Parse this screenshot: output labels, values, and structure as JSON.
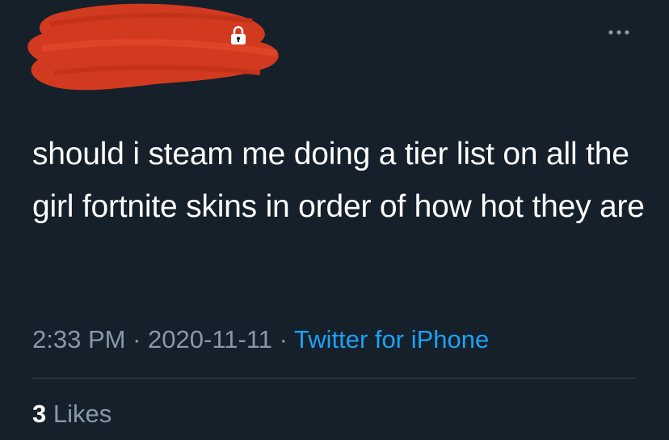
{
  "colors": {
    "background": "#15202b",
    "text_primary": "#ffffff",
    "text_secondary": "#8899a6",
    "link": "#1da1f2",
    "divider": "#38444d",
    "redaction": "#d23a1f"
  },
  "header": {
    "lock_icon": "lock-icon",
    "more_icon": "ellipsis-icon"
  },
  "tweet": {
    "text": "should i steam me doing a tier list on all the girl fortnite skins in order of how hot they are",
    "time": "2:33 PM",
    "separator": "·",
    "date": "2020-11-11",
    "source": "Twitter for iPhone"
  },
  "stats": {
    "likes_count": "3",
    "likes_label": "Likes"
  }
}
